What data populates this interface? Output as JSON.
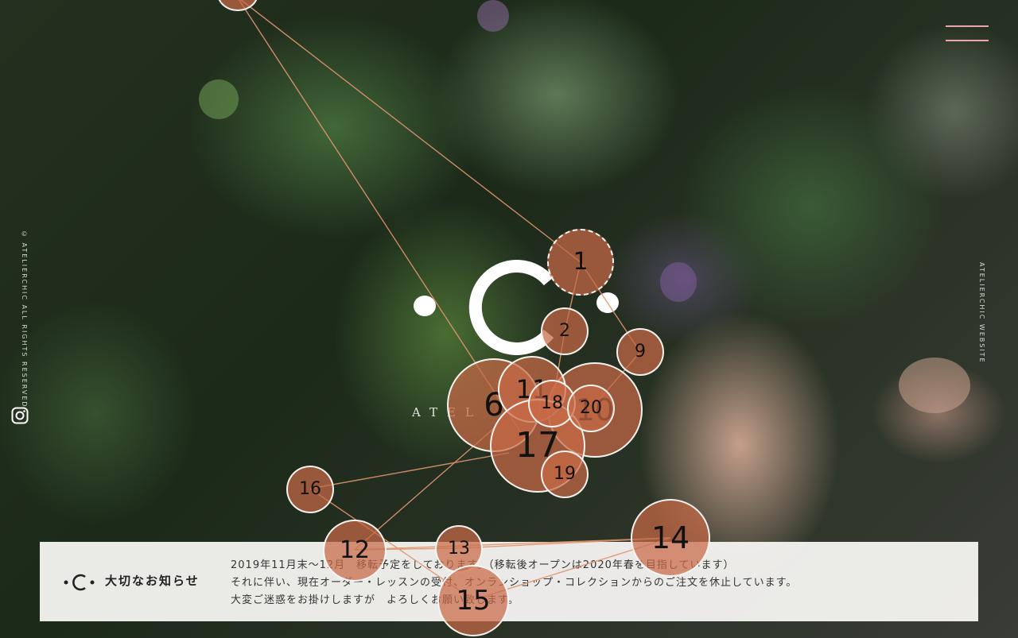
{
  "header": {
    "menu_icon": "hamburger-menu-icon"
  },
  "side": {
    "copyright": "© ATELIERCHIC ALL RIGHTS RESERVED",
    "site_label": "ATELIERCHIC WEBSITE",
    "social_icon": "instagram-icon"
  },
  "hero": {
    "logo_icon": "atelierchic-logo-mark",
    "logo_word": "ATEL"
  },
  "notice": {
    "logo_icon": "atelierchic-logo-small",
    "title": "大切なお知らせ",
    "lines": [
      "2019年11月末〜12月　移転予定をしております。（移転後オープンは2020年春を目指しています）",
      "それに伴い、現在オーダー・レッスンの受付、オンランショップ・コレクションからのご注文を休止しています。",
      "大変ご迷惑をお掛けしますが　よろしくお願い致します。"
    ]
  },
  "markers": [
    {
      "label": "1"
    },
    {
      "label": "2"
    },
    {
      "label": "6"
    },
    {
      "label": "9"
    },
    {
      "label": "10"
    },
    {
      "label": "11"
    },
    {
      "label": "12"
    },
    {
      "label": "13"
    },
    {
      "label": "14"
    },
    {
      "label": "15"
    },
    {
      "label": "16"
    },
    {
      "label": "17"
    },
    {
      "label": "18"
    },
    {
      "label": "19"
    },
    {
      "label": "20"
    },
    {
      "label": ""
    }
  ],
  "colors": {
    "menu_lines": "#e9a6ad",
    "marker_fill": "#c8694699",
    "connector": "#e0956e"
  }
}
